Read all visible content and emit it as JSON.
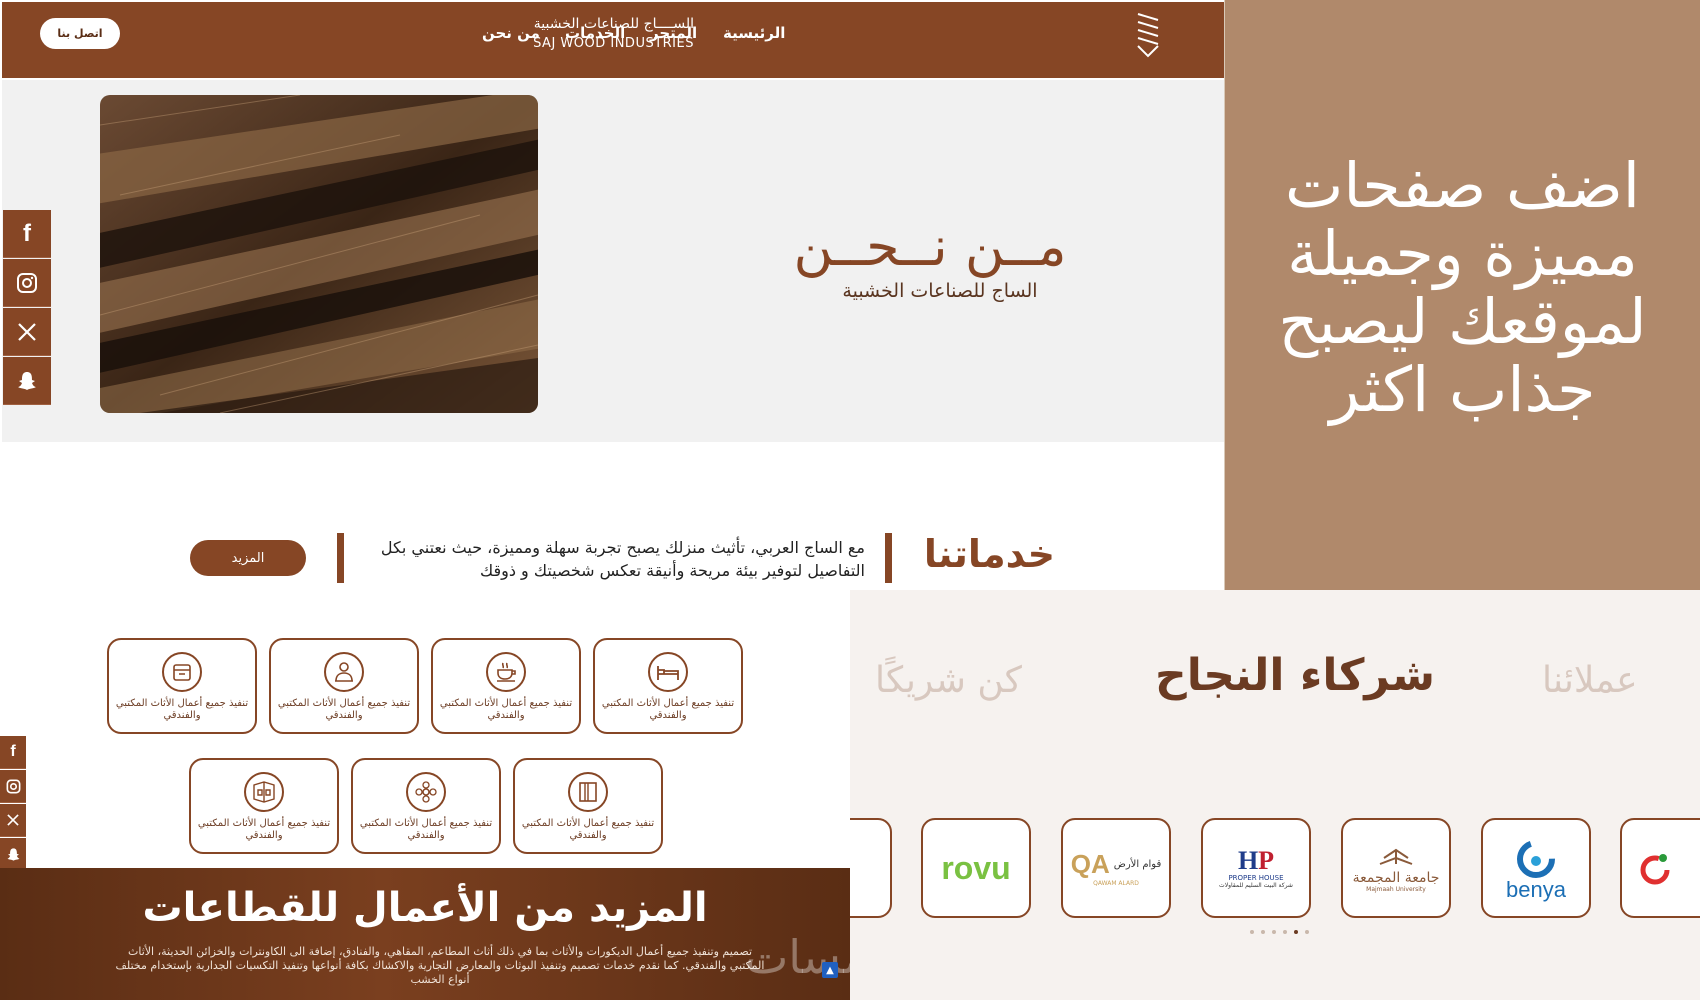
{
  "header": {
    "contact_button": "اتصل بنا",
    "nav": [
      "الرئيسية",
      "المتجر",
      "الخدمات",
      "من نحن"
    ],
    "logo_ar": "الســــاج للصناعات الخشبية",
    "logo_en": "SAJ WOOD INDUSTRIES"
  },
  "hero": {
    "title": "مــن نــحــن",
    "subtitle": "الساج للصناعات الخشبية"
  },
  "social": [
    "facebook-icon",
    "instagram-icon",
    "x-icon",
    "snapchat-icon"
  ],
  "services_intro": {
    "title": "خدماتنا",
    "text": "مع الساج العربي، تأثيث منزلك يصبح تجربة سهلة ومميزة، حيث نعتني بكل التفاصيل لتوفير بيئة مريحة وأنيقة تعكس شخصيتك و ذوقك",
    "more_button": "المزيد"
  },
  "promo": {
    "lines": [
      "اضف صفحات",
      "مميزة وجميلة",
      "لموقعك ليصبح",
      "جذاب اكثر"
    ]
  },
  "services": {
    "card_text": "تنفيذ جميع أعمال الأثاث المكتبي والفندقي",
    "cards": [
      {
        "icon": "bed-icon",
        "text": "تنفيذ جميع أعمال الأثاث المكتبي والفندقي"
      },
      {
        "icon": "coffee-cup-icon",
        "text": "تنفيذ جميع أعمال الأثاث المكتبي والفندقي"
      },
      {
        "icon": "chef-icon",
        "text": "تنفيذ جميع أعمال الأثاث المكتبي والفندقي"
      },
      {
        "icon": "food-box-icon",
        "text": "تنفيذ جميع أعمال الأثاث المكتبي والفندقي"
      },
      {
        "icon": "door-frame-icon",
        "text": "تنفيذ جميع أعمال الأثاث المكتبي والفندقي"
      },
      {
        "icon": "ornament-icon",
        "text": "تنفيذ جميع أعمال الأثاث المكتبي والفندقي"
      },
      {
        "icon": "room-corner-icon",
        "text": "تنفيذ جميع أعمال الأثاث المكتبي والفندقي"
      }
    ]
  },
  "more_works": {
    "title": "المزيد من الأعمال للقطاعات",
    "text": "تصميم وتنفيذ جميع أعمال الديكورات والأثاث بما في ذلك أثاث المطاعم، المقاهي، والفنادق، إضافة الى الكاونترات والخزائن الحديثة، الأثاث المكتبي والفندقي. كما نقدم خدمات تصميم وتنفيذ البوثات والمعارض التجارية والاكشاك بكافة أنواعها وتنفيذ التكسيات الجدارية بإستخدام مختلف أنواع الخشب",
    "watermark": "خمسات"
  },
  "partners": {
    "tabs": [
      "عملائنا",
      "شركاء النجاح",
      "كن شريكًا"
    ],
    "logos": [
      {
        "name": "benya-logo",
        "text": "benya"
      },
      {
        "name": "majmaah-university-logo",
        "text": "جامعة المجمعة",
        "sub": "Majmaah University"
      },
      {
        "name": "proper-house-logo",
        "text": "PROPER HOUSE",
        "sub": "شركة البيت السليم للمقاولات"
      },
      {
        "name": "qawam-alard-logo",
        "text": "قوام الأرض",
        "sub": "QAWAM ALARD"
      },
      {
        "name": "rovu-logo",
        "text": "rovu"
      }
    ]
  },
  "colors": {
    "brand": "#864625",
    "promo_bg": "#b0896b",
    "hero_bg": "#f1f1f1",
    "partners_bg": "#f6f2ef"
  }
}
